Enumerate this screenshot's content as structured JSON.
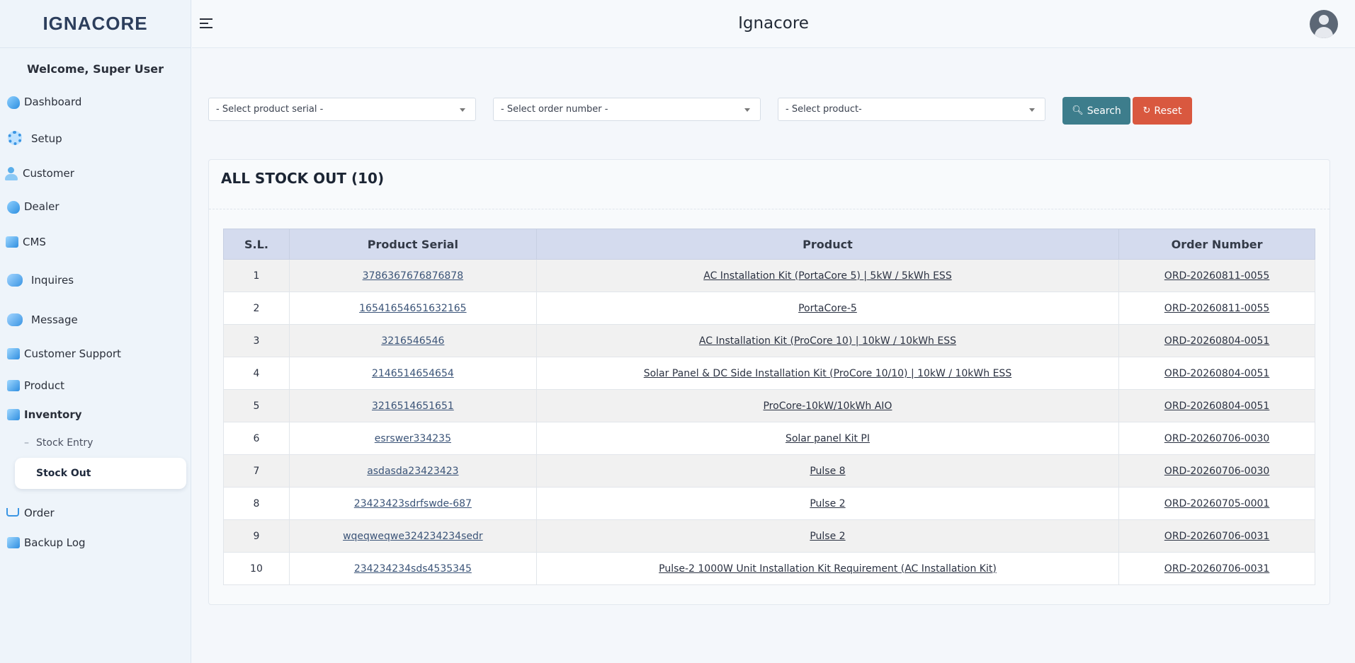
{
  "brand": {
    "logo_text": "IGNACORE"
  },
  "header": {
    "title": "Ignacore"
  },
  "sidebar": {
    "welcome": "Welcome, Super User",
    "items": [
      {
        "label": "Dashboard"
      },
      {
        "label": "Setup"
      },
      {
        "label": "Customer"
      },
      {
        "label": "Dealer"
      },
      {
        "label": "CMS"
      },
      {
        "label": "Inquires"
      },
      {
        "label": "Message"
      },
      {
        "label": "Customer Support"
      },
      {
        "label": "Product"
      },
      {
        "label": "Inventory"
      },
      {
        "label": "Order"
      },
      {
        "label": "Backup Log"
      }
    ],
    "inventory_sub": [
      {
        "label": "Stock Entry"
      },
      {
        "label": "Stock Out"
      }
    ]
  },
  "filters": {
    "product_serial": "- Select product serial -",
    "order_number": "- Select order number -",
    "product": "- Select product-",
    "search_label": "Search",
    "reset_label": "Reset"
  },
  "card": {
    "title": "ALL STOCK OUT (10)"
  },
  "table": {
    "headers": [
      "S.L.",
      "Product Serial",
      "Product",
      "Order Number"
    ],
    "rows": [
      {
        "sl": "1",
        "serial": "3786367676876878",
        "product": "AC Installation Kit (PortaCore 5) | 5kW / 5kWh ESS",
        "order": "ORD-20260811-0055"
      },
      {
        "sl": "2",
        "serial": "16541654651632165",
        "product": "PortaCore-5",
        "order": "ORD-20260811-0055"
      },
      {
        "sl": "3",
        "serial": "3216546546",
        "product": "AC Installation Kit (ProCore 10) | 10kW / 10kWh ESS",
        "order": "ORD-20260804-0051"
      },
      {
        "sl": "4",
        "serial": "2146514654654",
        "product": "Solar Panel & DC Side Installation Kit (ProCore 10/10) | 10kW / 10kWh ESS",
        "order": "ORD-20260804-0051"
      },
      {
        "sl": "5",
        "serial": "3216514651651",
        "product": "ProCore-10kW/10kWh AIO",
        "order": "ORD-20260804-0051"
      },
      {
        "sl": "6",
        "serial": "esrswer334235",
        "product": "Solar panel Kit PI",
        "order": "ORD-20260706-0030"
      },
      {
        "sl": "7",
        "serial": "asdasda23423423",
        "product": "Pulse 8",
        "order": "ORD-20260706-0030"
      },
      {
        "sl": "8",
        "serial": "23423423sdrfswde-687",
        "product": "Pulse 2",
        "order": "ORD-20260705-0001"
      },
      {
        "sl": "9",
        "serial": "wqeqweqwe324234234sedr",
        "product": "Pulse 2",
        "order": "ORD-20260706-0031"
      },
      {
        "sl": "10",
        "serial": "234234234sds4535345",
        "product": "Pulse-2 1000W Unit Installation Kit Requirement (AC Installation Kit)",
        "order": "ORD-20260706-0031"
      }
    ]
  },
  "colors": {
    "search_button": "#3d7d8c",
    "reset_button": "#d9583f",
    "table_header": "#d4dbee"
  }
}
